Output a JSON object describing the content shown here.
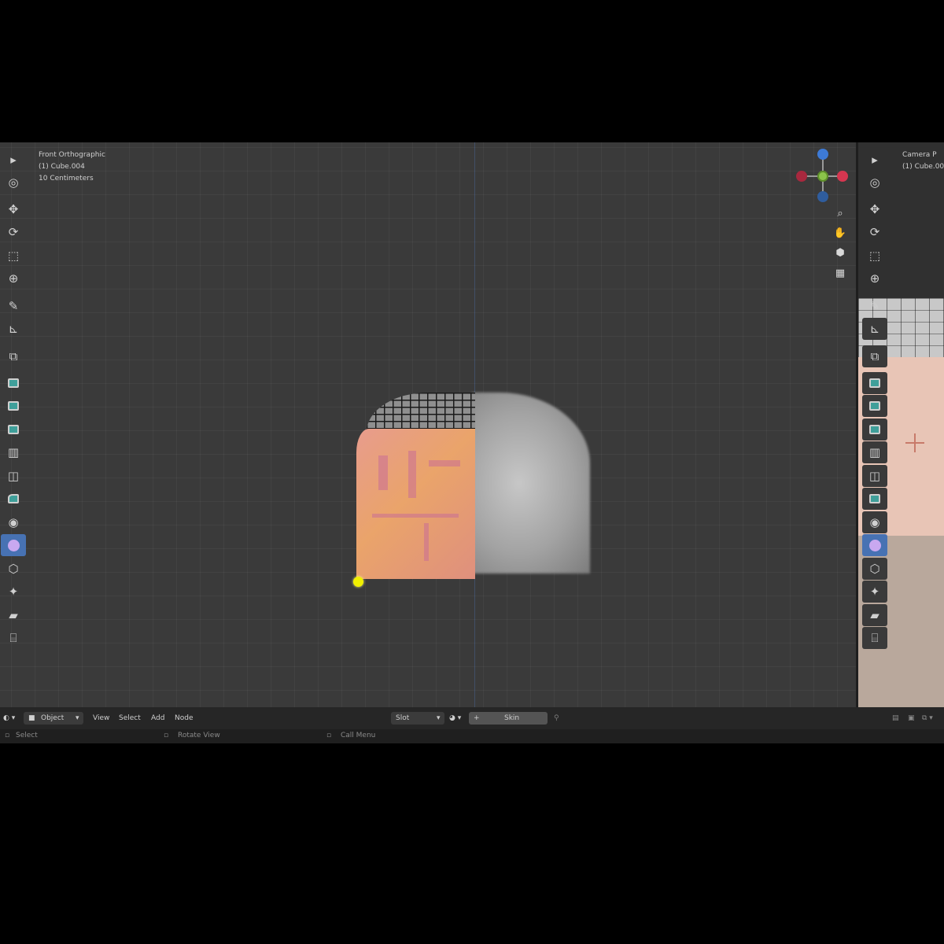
{
  "viewport": {
    "view_name": "Front Orthographic",
    "object_name": "(1) Cube.004",
    "units": "10 Centimeters"
  },
  "camera_viewport": {
    "view_name": "Camera P",
    "object_name": "(1) Cube.00"
  },
  "gizmo": {
    "axis_colors": {
      "x": "#d63650",
      "y": "#6aa62a",
      "z": "#3d7ad6"
    },
    "center_color": "#8bc34a"
  },
  "toolbar": {
    "items": [
      {
        "icon": "select-box-icon"
      },
      {
        "icon": "cursor-icon"
      },
      {
        "icon": "move-icon"
      },
      {
        "icon": "rotate-icon"
      },
      {
        "icon": "scale-icon"
      },
      {
        "icon": "transform-icon"
      },
      {
        "icon": "annotate-icon"
      },
      {
        "icon": "measure-icon"
      },
      {
        "icon": "add-cube-icon"
      },
      {
        "icon": "extrude-icon"
      },
      {
        "icon": "inset-icon"
      },
      {
        "icon": "bevel-icon"
      },
      {
        "icon": "loop-cut-icon"
      },
      {
        "icon": "knife-icon"
      },
      {
        "icon": "poly-build-icon"
      },
      {
        "icon": "spin-icon"
      },
      {
        "icon": "smooth-icon"
      },
      {
        "icon": "edge-slide-icon"
      },
      {
        "icon": "shrink-icon"
      },
      {
        "icon": "shear-icon"
      },
      {
        "icon": "rip-icon"
      }
    ],
    "active_index": 16
  },
  "header": {
    "mode": "Object",
    "menus": [
      "View",
      "Select",
      "Add",
      "Node"
    ],
    "slot": "Slot",
    "material": "Skin"
  },
  "status": {
    "select": "Select",
    "rotate_view": "Rotate View",
    "call_menu": "Call Menu"
  },
  "colors": {
    "selection_orange": "#e9a36a",
    "active_tool": "#4772b3",
    "active_vertex": "#f0f000"
  }
}
